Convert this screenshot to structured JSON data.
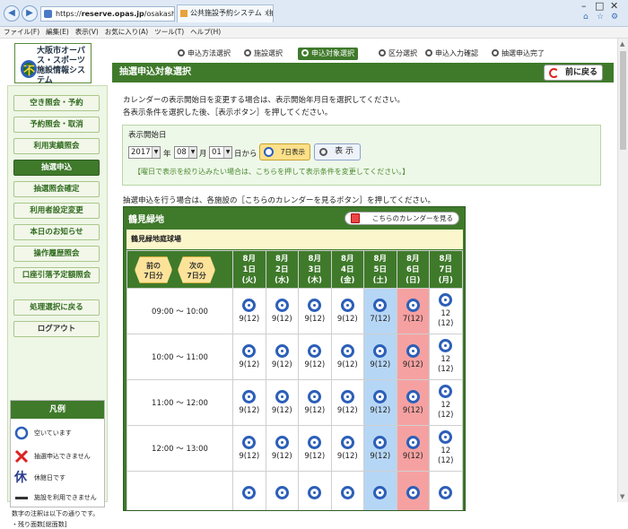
{
  "browser": {
    "address_prefix": "https://",
    "address_host": "reserve.opas.jp",
    "address_path": "/osakashi/",
    "tab_title": "公共施設予約システム（抽...",
    "menu": [
      "ファイル(F)",
      "編集(E)",
      "表示(V)",
      "お気に入り(A)",
      "ツール(T)",
      "ヘルプ(H)"
    ]
  },
  "logo": {
    "text": "大阪市オーパス・スポーツ施設情報システム",
    "mark": "不"
  },
  "nav": [
    {
      "label": "空き照会・予約"
    },
    {
      "label": "予約照会・取消"
    },
    {
      "label": "利用実績照会"
    },
    {
      "label": "抽選申込",
      "active": true
    },
    {
      "label": "抽選照会確定"
    },
    {
      "label": "利用者設定変更"
    },
    {
      "label": "本日のお知らせ"
    },
    {
      "label": "操作履歴照会"
    },
    {
      "label": "口座引落予定額照会"
    },
    {
      "label": "処理選択に戻る"
    },
    {
      "label": "ログアウト"
    }
  ],
  "legend": {
    "title": "凡例",
    "items": [
      {
        "icon": "open-circle-icon",
        "text": "空いています"
      },
      {
        "icon": "x-mark-icon",
        "text": "抽選申込できません"
      },
      {
        "icon": "kyu-icon",
        "text": "休館日です",
        "glyph": "休"
      },
      {
        "icon": "dash-icon",
        "text": "施設を利用できません"
      }
    ],
    "note": "数字の注釈は以下の通りです。",
    "note2": "・残り面数[総面数]"
  },
  "steps": [
    {
      "label": "申込方法選択"
    },
    {
      "label": "施設選択"
    },
    {
      "label": "申込対象選択",
      "active": true
    },
    {
      "label": "区分選択"
    },
    {
      "label": "申込入力確認"
    },
    {
      "label": "抽選申込完了"
    }
  ],
  "main": {
    "title": "抽選申込対象選択",
    "back_button": "前に戻る",
    "desc1": "カレンダーの表示開始日を変更する場合は、表示開始年月日を選択してください。",
    "desc2": "各表示条件を選択した後、［表示ボタン］を押してください。",
    "date_label": "表示開始日",
    "year": "2017",
    "year_unit": "年",
    "month": "08",
    "month_unit": "月",
    "day": "01",
    "day_unit": "日から",
    "days_button": "7日表示",
    "show_button": "表 示",
    "date_note": "【曜日で表示を絞り込みたい場合は、こちらを押して表示条件を変更してください。】",
    "instruction": "抽選申込を行う場合は、各施設の［こちらのカレンダーを見るボタン］を押してください。"
  },
  "facility": {
    "name": "鶴見緑地",
    "calendar_button": "こちらのカレンダーを見る",
    "sub_name": "鶴見緑地庭球場",
    "prev_label": [
      "前の",
      "7日分"
    ],
    "next_label": [
      "次の",
      "7日分"
    ],
    "days": [
      {
        "m": "8月",
        "d": "1日",
        "w": "(火)",
        "type": "weekday"
      },
      {
        "m": "8月",
        "d": "2日",
        "w": "(水)",
        "type": "weekday"
      },
      {
        "m": "8月",
        "d": "3日",
        "w": "(木)",
        "type": "weekday"
      },
      {
        "m": "8月",
        "d": "4日",
        "w": "(金)",
        "type": "weekday"
      },
      {
        "m": "8月",
        "d": "5日",
        "w": "(土)",
        "type": "sat"
      },
      {
        "m": "8月",
        "d": "6日",
        "w": "(日)",
        "type": "sun"
      },
      {
        "m": "8月",
        "d": "7日",
        "w": "(月)",
        "type": "weekday"
      }
    ],
    "slots": [
      {
        "time": "09:00 ～ 10:00",
        "counts": [
          "9(12)",
          "9(12)",
          "9(12)",
          "9(12)",
          "7(12)",
          "7(12)",
          "12\n(12)"
        ]
      },
      {
        "time": "10:00 ～ 11:00",
        "counts": [
          "9(12)",
          "9(12)",
          "9(12)",
          "9(12)",
          "9(12)",
          "9(12)",
          "12\n(12)"
        ]
      },
      {
        "time": "11:00 ～ 12:00",
        "counts": [
          "9(12)",
          "9(12)",
          "9(12)",
          "9(12)",
          "9(12)",
          "9(12)",
          "12\n(12)"
        ]
      },
      {
        "time": "12:00 ～ 13:00",
        "counts": [
          "9(12)",
          "9(12)",
          "9(12)",
          "9(12)",
          "9(12)",
          "9(12)",
          "12\n(12)"
        ]
      },
      {
        "time": "",
        "counts": [
          "",
          "",
          "",
          "",
          "",
          "",
          ""
        ]
      }
    ]
  }
}
